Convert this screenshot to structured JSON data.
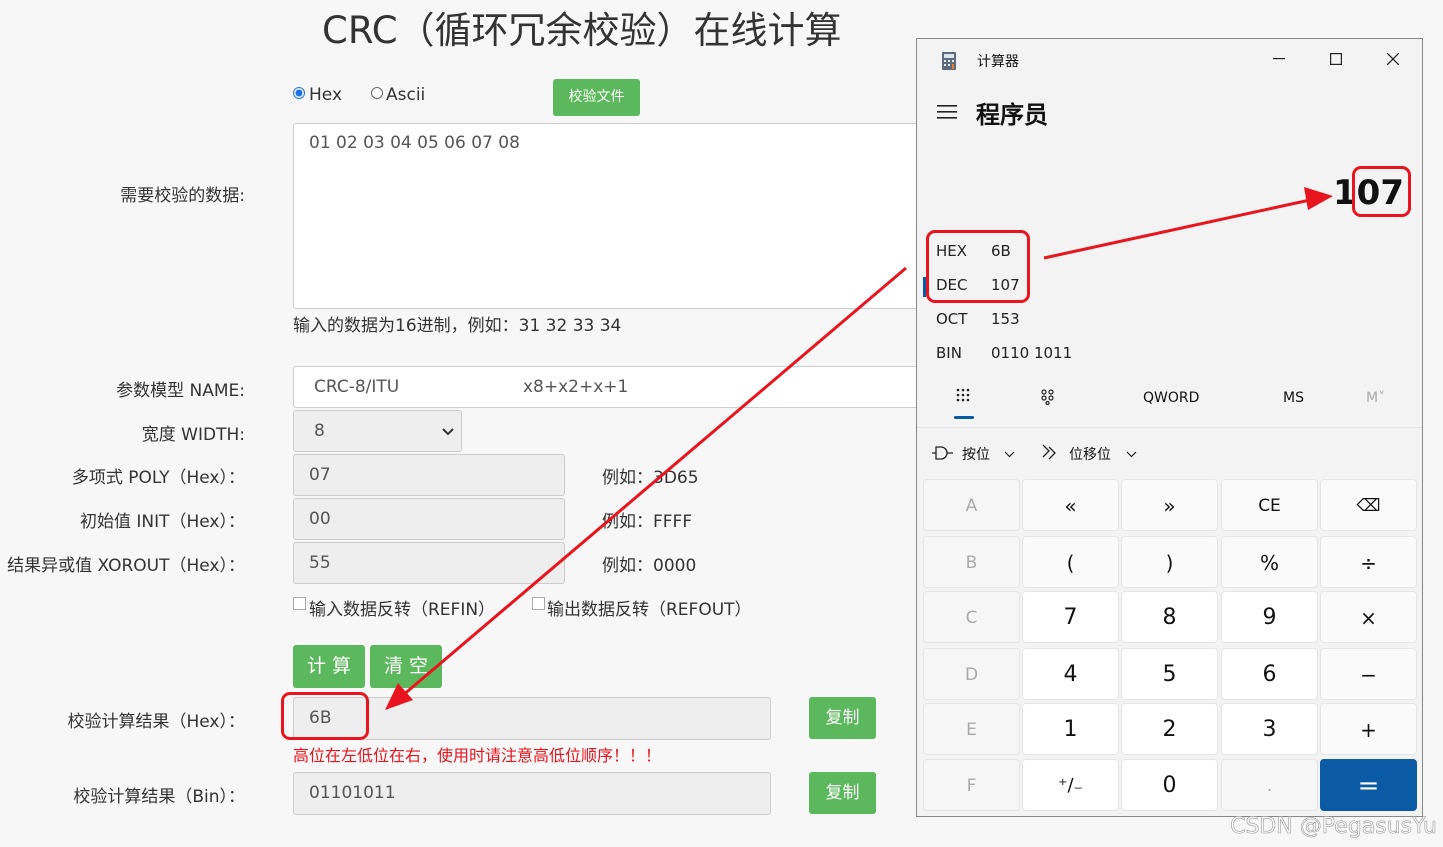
{
  "page": {
    "title": "CRC（循环冗余校验）在线计算",
    "radio_hex": "Hex",
    "radio_ascii": "Ascii",
    "file_button": "校验文件",
    "data_label": "需要校验的数据:",
    "data_value": "01 02 03 04 05 06 07 08",
    "data_hint": "输入的数据为16进制，例如：31 32 33 34",
    "model_label": "参数模型 NAME:",
    "model_value": "CRC-8/ITU",
    "model_poly_text": "x8+x2+x+1",
    "width_label": "宽度 WIDTH:",
    "width_value": "8",
    "poly_label": "多项式 POLY（Hex）：",
    "poly_value": "07",
    "poly_hint": "例如：3D65",
    "init_label": "初始值 INIT（Hex）：",
    "init_value": "00",
    "init_hint": "例如：FFFF",
    "xorout_label": "结果异或值 XOROUT（Hex）：",
    "xorout_value": "55",
    "xorout_hint": "例如：0000",
    "refin_label": "输入数据反转（REFIN）",
    "refout_label": "输出数据反转（REFOUT）",
    "calc_button": "计 算",
    "clear_button": "清 空",
    "result_hex_label": "校验计算结果（Hex）：",
    "result_hex_value": "6B",
    "result_warning": "高位在左低位在右，使用时请注意高低位顺序！！！",
    "result_bin_label": "校验计算结果（Bin）：",
    "result_bin_value": "01101011",
    "copy_button": "复制"
  },
  "calculator": {
    "window_title": "计算器",
    "mode": "程序员",
    "display": "107",
    "radix": [
      {
        "name": "HEX",
        "value": "6B"
      },
      {
        "name": "DEC",
        "value": "107"
      },
      {
        "name": "OCT",
        "value": "153"
      },
      {
        "name": "BIN",
        "value": "0110 1011"
      }
    ],
    "word_size": "QWORD",
    "memory_store": "MS",
    "memory_recall": "M˅",
    "bitwise_label": "按位",
    "bitshift_label": "位移位",
    "keys": {
      "a": "A",
      "b": "B",
      "c": "C",
      "d": "D",
      "e": "E",
      "f": "F",
      "lshift": "«",
      "rshift": "»",
      "ce": "CE",
      "back": "⌫",
      "lparen": "(",
      "rparen": ")",
      "percent": "%",
      "divide": "÷",
      "seven": "7",
      "eight": "8",
      "nine": "9",
      "multiply": "×",
      "four": "4",
      "five": "5",
      "six": "6",
      "minus": "−",
      "one": "1",
      "two": "2",
      "three": "3",
      "plus": "+",
      "negate": "⁺∕₋",
      "zero": "0",
      "dot": ".",
      "equals": "="
    }
  },
  "watermark": "CSDN @PegasusYu",
  "colors": {
    "green": "#5cb85c",
    "annotation_red": "#e8141e",
    "equals_blue": "#0a5aa5"
  }
}
